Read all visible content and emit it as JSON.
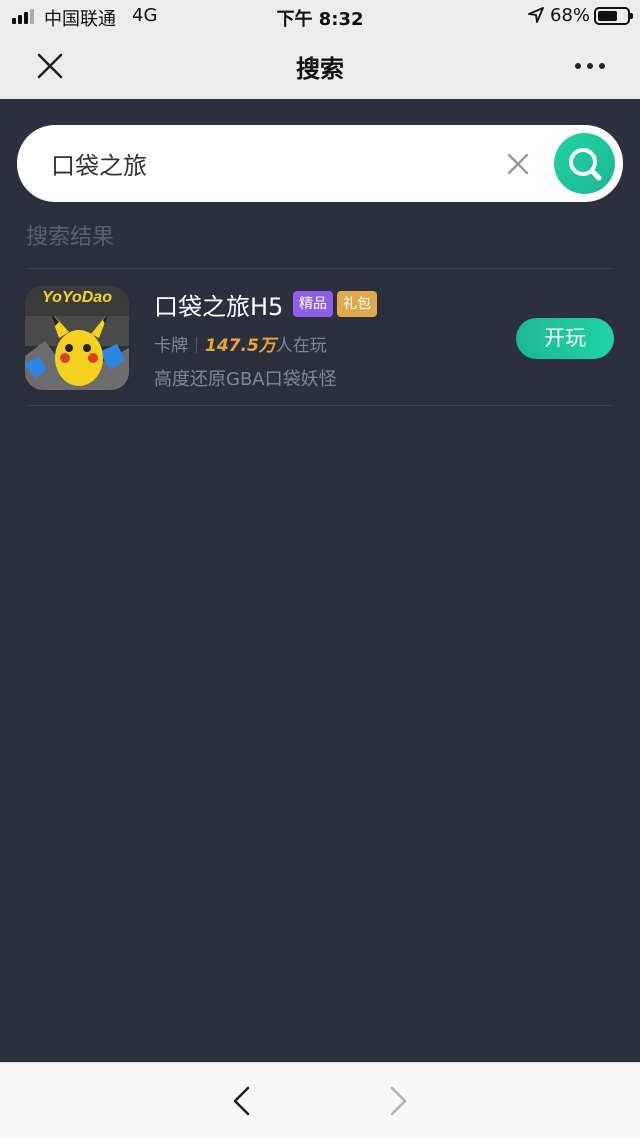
{
  "status_bar": {
    "carrier": "中国联通",
    "network": "4G",
    "time": "下午 8:32",
    "battery": "68%",
    "battery_level": 0.68
  },
  "nav": {
    "title": "搜索",
    "close_icon": "close-icon",
    "more_icon": "more-icon"
  },
  "search": {
    "value": "口袋之旅",
    "clear_icon": "close-icon",
    "search_icon": "search-icon",
    "accent": "#21d4a4"
  },
  "results": {
    "label": "搜索结果",
    "items": [
      {
        "name": "口袋之旅H5",
        "badges": [
          "精品",
          "礼包"
        ],
        "badge_colors": [
          "#8f5ee8",
          "#dfa94c"
        ],
        "category": "卡牌",
        "players": "147.5万",
        "players_suffix": "人在玩",
        "description": "高度还原GBA口袋妖怪",
        "play_label": "开玩",
        "icon_logo_text": "YoYoDao"
      }
    ]
  },
  "bottom_nav": {
    "back_icon": "chevron-left-icon",
    "forward_icon": "chevron-right-icon"
  }
}
